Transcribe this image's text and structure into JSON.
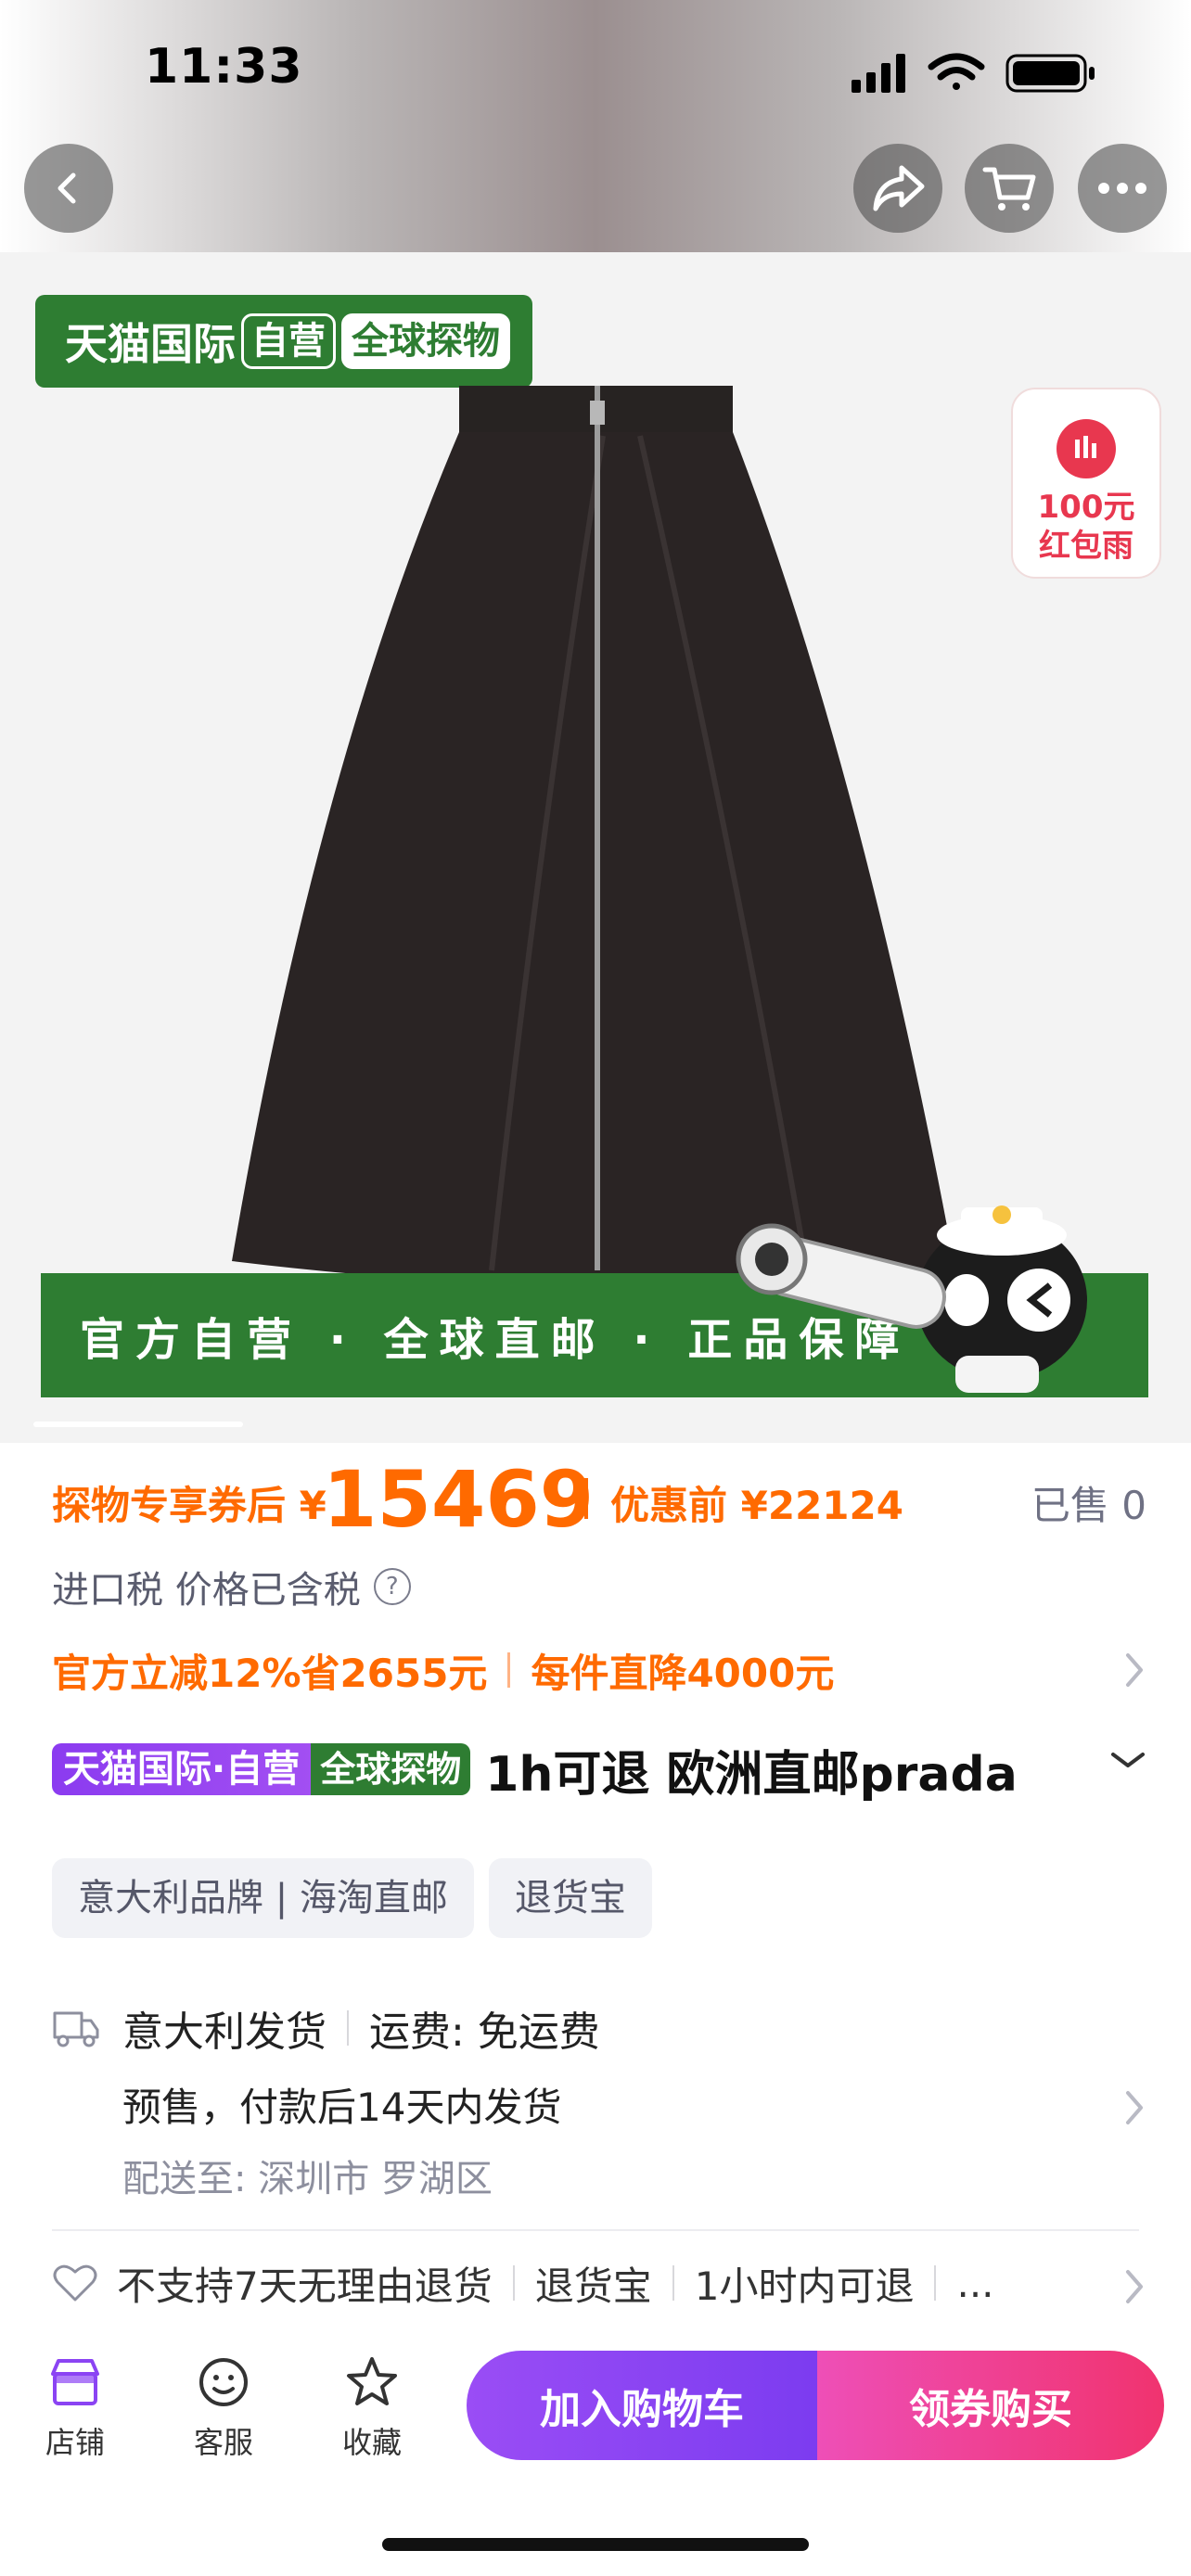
{
  "status": {
    "time": "11:33"
  },
  "hero": {
    "badge": {
      "brand": "天猫国际",
      "self": "自营",
      "global": "全球探物"
    },
    "red_packet": {
      "line1": "100元",
      "line2": "红包雨"
    },
    "banner": "官方自营 · 全球直邮 · 正品保障"
  },
  "price": {
    "label": "探物专享券后",
    "currency": "¥",
    "amount": "15469",
    "orig_label": "优惠前",
    "orig_amount": "¥22124",
    "sold": "已售 0"
  },
  "tax": {
    "text": "进口税 价格已含税"
  },
  "promo": {
    "item1": "官方立减12%省2655元",
    "item2": "每件直降4000元"
  },
  "title": {
    "badge1": "天猫国际·自营",
    "badge2": "全球探物",
    "text": "1h可退 欧洲直邮prada"
  },
  "tags": [
    "意大利品牌 | 海淘直邮",
    "退货宝"
  ],
  "shipping": {
    "origin": "意大利发货",
    "fee": "运费: 免运费",
    "presale": "预售，付款后14天内发货",
    "destination": "配送至: 深圳市 罗湖区"
  },
  "service": {
    "item1": "不支持7天无理由退货",
    "item2": "退货宝",
    "item3": "1小时内可退",
    "more": "..."
  },
  "bottom_bar": {
    "store": "店铺",
    "service": "客服",
    "favorite": "收藏",
    "add_cart": "加入购物车",
    "buy": "领券购买"
  },
  "colors": {
    "accent_orange": "#ff6a00",
    "tmall_green": "#2e7d32",
    "cart_purple": "#8b44f3",
    "buy_pink": "#f0336f"
  }
}
